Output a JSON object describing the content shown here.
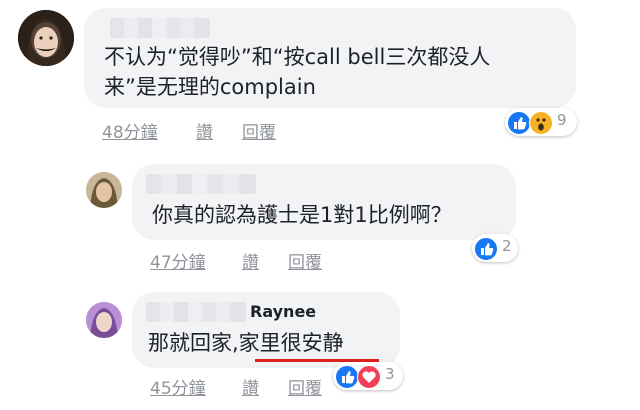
{
  "comments": [
    {
      "name": "",
      "text_line1": "不认为“觉得吵”和“按call bell三次都没人",
      "text_line2": "来”是无理的complain",
      "time": "48分鐘",
      "like_label": "讚",
      "reply_label": "回覆",
      "reaction_count": "9",
      "reactions": [
        "like-icon",
        "wow-icon"
      ]
    },
    {
      "name": "",
      "text_line1": "你真的認為護士是1對1比例啊？",
      "time": "47分鐘",
      "like_label": "讚",
      "reply_label": "回覆",
      "reaction_count": "2",
      "reactions": [
        "like-icon"
      ]
    },
    {
      "name": "Raynee",
      "text_line1": "那就回家,家里很安静",
      "time": "45分鐘",
      "like_label": "讚",
      "reply_label": "回覆",
      "reaction_count": "3",
      "reactions": [
        "like-icon",
        "love-icon"
      ]
    }
  ],
  "colors": {
    "like": "#1877f2",
    "love": "#f33e58",
    "wow": "#f7b125",
    "bubble": "#f2f3f5",
    "highlight_underline": "#e0201b"
  }
}
